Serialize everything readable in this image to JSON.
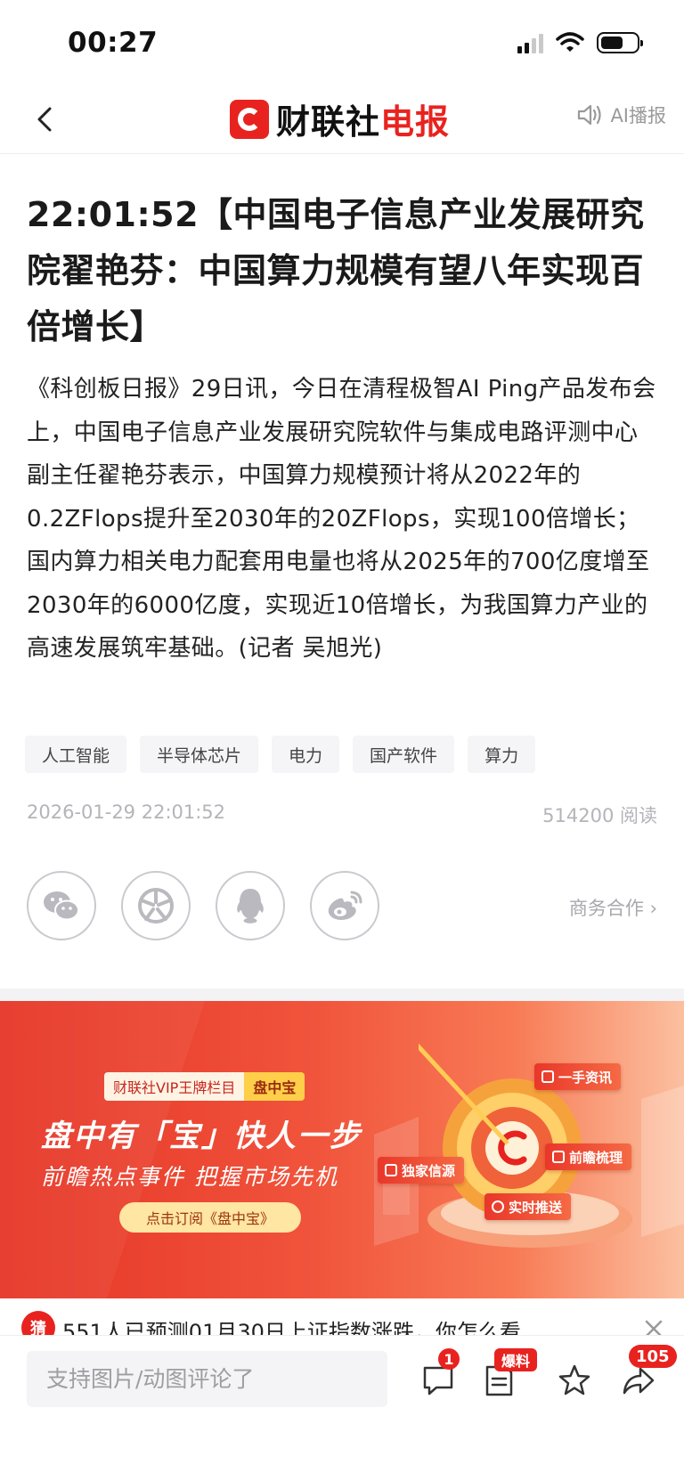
{
  "status_bar": {
    "time": "00:27"
  },
  "nav": {
    "brand_part1": "财联社",
    "brand_part2": "电报",
    "ai_play_label": "AI播报"
  },
  "article": {
    "headline": "22:01:52【中国电子信息产业发展研究院翟艳芬：中国算力规模有望八年实现百倍增长】",
    "body": "《科创板日报》29日讯，今日在清程极智AI Ping产品发布会上，中国电子信息产业发展研究院软件与集成电路评测中心副主任翟艳芬表示，中国算力规模预计将从2022年的0.2ZFlops提升至2030年的20ZFlops，实现100倍增长；国内算力相关电力配套用电量也将从2025年的700亿度增至2030年的6000亿度，实现近10倍增长，为我国算力产业的高速发展筑牢基础。(记者 吴旭光)",
    "tags": [
      "人工智能",
      "半导体芯片",
      "电力",
      "国产软件",
      "算力"
    ],
    "datetime": "2026-01-29 22:01:52",
    "reads": "514200 阅读"
  },
  "share": {
    "icons": [
      "wechat-icon",
      "moments-icon",
      "qq-icon",
      "weibo-icon"
    ],
    "business_label": "商务合作 ›"
  },
  "banner": {
    "pill_left": "财联社VIP王牌栏目",
    "pill_right": "盘中宝",
    "title": "盘中有「宝」快人一步",
    "subtitle": "前瞻热点事件 把握市场先机",
    "button": "点击订阅《盘中宝》",
    "chip1": "一手资讯",
    "chip2": "独家信源",
    "chip3": "前瞻梳理",
    "chip4": "实时推送"
  },
  "notice": {
    "badge": "猜",
    "text": "551人已预测01月30日上证指数涨跌，你怎么看"
  },
  "bottom_bar": {
    "comment_placeholder": "支持图片/动图评论了",
    "comment_badge": "1",
    "tipoff_badge": "爆料",
    "share_count": "105"
  },
  "colors": {
    "brand_red": "#e8231f",
    "muted_gray": "#b4b4b9"
  }
}
